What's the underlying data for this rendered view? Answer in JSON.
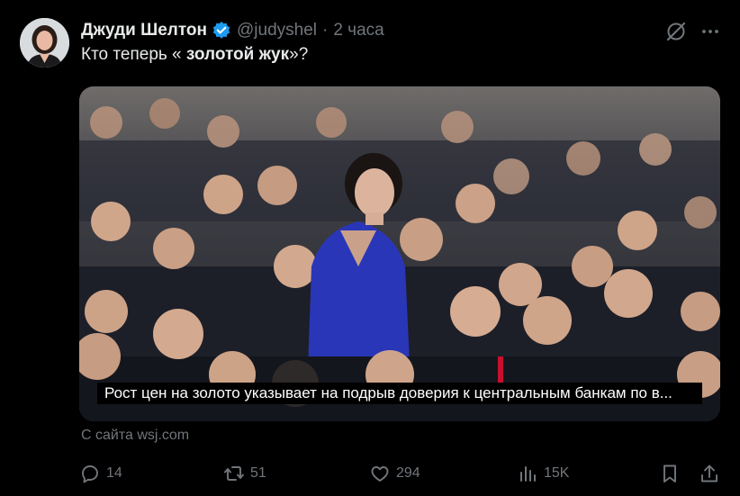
{
  "author": {
    "name": "Джуди Шелтон",
    "handle": "@judyshel",
    "separator": "·",
    "time": "2 часа"
  },
  "tweet": {
    "text_before": "Кто теперь « ",
    "text_bold": "золотой жук",
    "text_after": "»?"
  },
  "media": {
    "caption": "Рост цен на золото указывает на подрыв доверия к центральным банкам по в..."
  },
  "card_source": "С сайта wsj.com",
  "actions": {
    "replies": "14",
    "reposts": "51",
    "likes": "294",
    "views": "15K"
  },
  "colors": {
    "background": "#000000",
    "text": "#e7e9ea",
    "muted": "#71767b",
    "verified": "#1d9bf0"
  },
  "icons": {
    "verified": "verified-badge-icon",
    "grok": "grok-icon",
    "more": "more-icon",
    "reply": "reply-icon",
    "repost": "repost-icon",
    "like": "heart-icon",
    "views": "views-icon",
    "bookmark": "bookmark-icon",
    "share": "share-icon"
  }
}
